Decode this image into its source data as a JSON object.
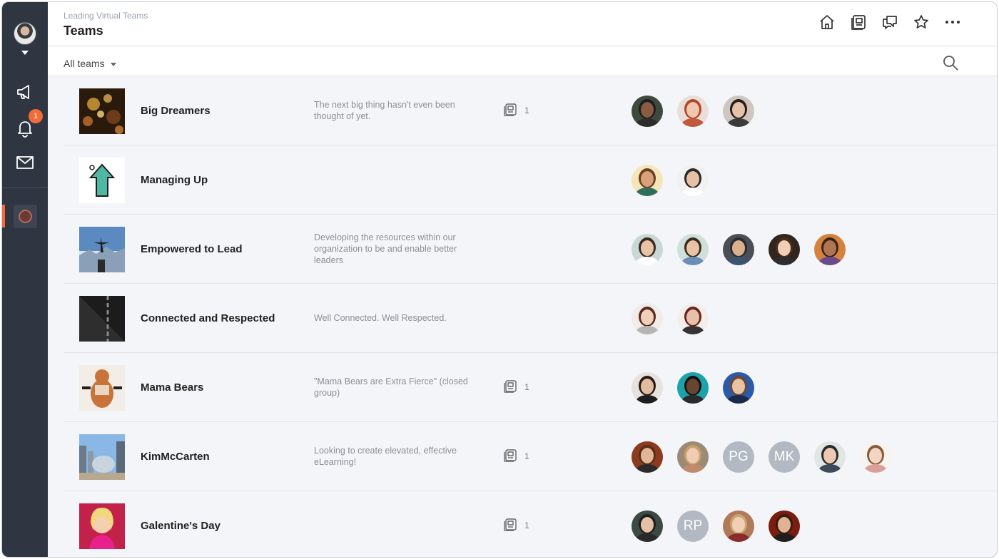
{
  "header": {
    "breadcrumb": "Leading Virtual Teams",
    "title": "Teams",
    "icons": [
      "home-icon",
      "pages-icon",
      "conversations-icon",
      "star-icon",
      "more-icon"
    ]
  },
  "sidebar": {
    "notification_count": "1",
    "icons": [
      "megaphone-icon",
      "bell-icon",
      "mail-icon"
    ]
  },
  "filter": {
    "label": "All teams"
  },
  "teams": [
    {
      "name": "Big Dreamers",
      "description": "The next big thing hasn't even been thought of yet.",
      "pages": "1",
      "members": [
        {
          "type": "photo",
          "skin": "#8a5a44",
          "hair": "#1e1e1e",
          "bg": "#3e4a3c",
          "shirt": "#2c2c2c"
        },
        {
          "type": "photo",
          "skin": "#f0c6ad",
          "hair": "#b3452c",
          "bg": "#e8e0d8",
          "shirt": "#c05a3a"
        },
        {
          "type": "photo",
          "skin": "#e5c2a8",
          "hair": "#2a1d17",
          "bg": "#cfc7bf",
          "shirt": "#3b3b3b"
        }
      ]
    },
    {
      "name": "Managing Up",
      "description": "",
      "pages": "",
      "members": [
        {
          "type": "photo",
          "skin": "#d9a07a",
          "hair": "#6b3f22",
          "bg": "#f3e6b8",
          "shirt": "#2f6e5a"
        },
        {
          "type": "photo",
          "skin": "#e6c1a6",
          "hair": "#2a2a2a",
          "bg": "#f1f1f1",
          "shirt": "#ffffff"
        }
      ]
    },
    {
      "name": "Empowered to Lead",
      "description": "Developing the resources within our organization to be and enable better leaders",
      "pages": "",
      "members": [
        {
          "type": "photo",
          "skin": "#e7c4a5",
          "hair": "#3a2a20",
          "bg": "#c9d8d4",
          "shirt": "#ffffff"
        },
        {
          "type": "photo",
          "skin": "#e8c3a4",
          "hair": "#3b2b1f",
          "bg": "#cfe0da",
          "shirt": "#6b8db8"
        },
        {
          "type": "photo",
          "skin": "#d9b08f",
          "hair": "#2c2c2c",
          "bg": "#4a4f57",
          "shirt": "#3d5470"
        },
        {
          "type": "photo",
          "skin": "#f0cfb5",
          "hair": "#4a2c1c",
          "bg": "#2f2620",
          "shirt": "#2d2d2d"
        },
        {
          "type": "photo",
          "skin": "#b07556",
          "hair": "#3a2412",
          "bg": "#d4823e",
          "shirt": "#6a4a8a"
        }
      ]
    },
    {
      "name": "Connected and Respected",
      "description": "Well Connected. Well Respected.",
      "pages": "",
      "members": [
        {
          "type": "photo",
          "skin": "#f1d0bb",
          "hair": "#5a2a22",
          "bg": "#f1ece8",
          "shirt": "#b5b5b5"
        },
        {
          "type": "photo",
          "skin": "#e8c0aa",
          "hair": "#6b2420",
          "bg": "#f3eeea",
          "shirt": "#333333"
        }
      ]
    },
    {
      "name": "Mama Bears",
      "description": "\"Mama Bears are Extra Fierce\" (closed group)",
      "pages": "1",
      "members": [
        {
          "type": "photo",
          "skin": "#e2bca0",
          "hair": "#2a1c14",
          "bg": "#e6e2de",
          "shirt": "#1e1e1e"
        },
        {
          "type": "photo",
          "skin": "#6a4432",
          "hair": "#111111",
          "bg": "#1aa3a8",
          "shirt": "#2a2a2a"
        },
        {
          "type": "photo",
          "skin": "#e8c2a5",
          "hair": "#6b4830",
          "bg": "#2d5aa8",
          "shirt": "#1c2a4a"
        }
      ]
    },
    {
      "name": "KimMcCarten",
      "description": "Looking to create elevated, effective eLearning!",
      "pages": "1",
      "members": [
        {
          "type": "photo",
          "skin": "#e2b699",
          "hair": "#5c2e18",
          "bg": "#8c3a20",
          "shirt": "#2a2a2a"
        },
        {
          "type": "photo",
          "skin": "#f0cdb2",
          "hair": "#c9a06a",
          "bg": "#9c8a78",
          "shirt": "#c28a6a"
        },
        {
          "type": "initials",
          "text": "PG"
        },
        {
          "type": "initials",
          "text": "MK"
        },
        {
          "type": "photo",
          "skin": "#ecc9b0",
          "hair": "#2a2a2a",
          "bg": "#dfe6e4",
          "shirt": "#3c4a5a"
        },
        {
          "type": "photo",
          "skin": "#f2d5c3",
          "hair": "#8a5a3a",
          "bg": "#f7f3ef",
          "shirt": "#d9a09a"
        }
      ]
    },
    {
      "name": "Galentine's Day",
      "description": "",
      "pages": "1",
      "members": [
        {
          "type": "photo",
          "skin": "#e3c0a6",
          "hair": "#1e1e1e",
          "bg": "#3c4a44",
          "shirt": "#2a2a2a"
        },
        {
          "type": "initials",
          "text": "RP"
        },
        {
          "type": "photo",
          "skin": "#f0cfb4",
          "hair": "#caa470",
          "bg": "#b07a5a",
          "shirt": "#8a2a2a"
        },
        {
          "type": "photo",
          "skin": "#e0b394",
          "hair": "#3a1c10",
          "bg": "#7a1c10",
          "shirt": "#1e1e1e"
        }
      ]
    }
  ]
}
